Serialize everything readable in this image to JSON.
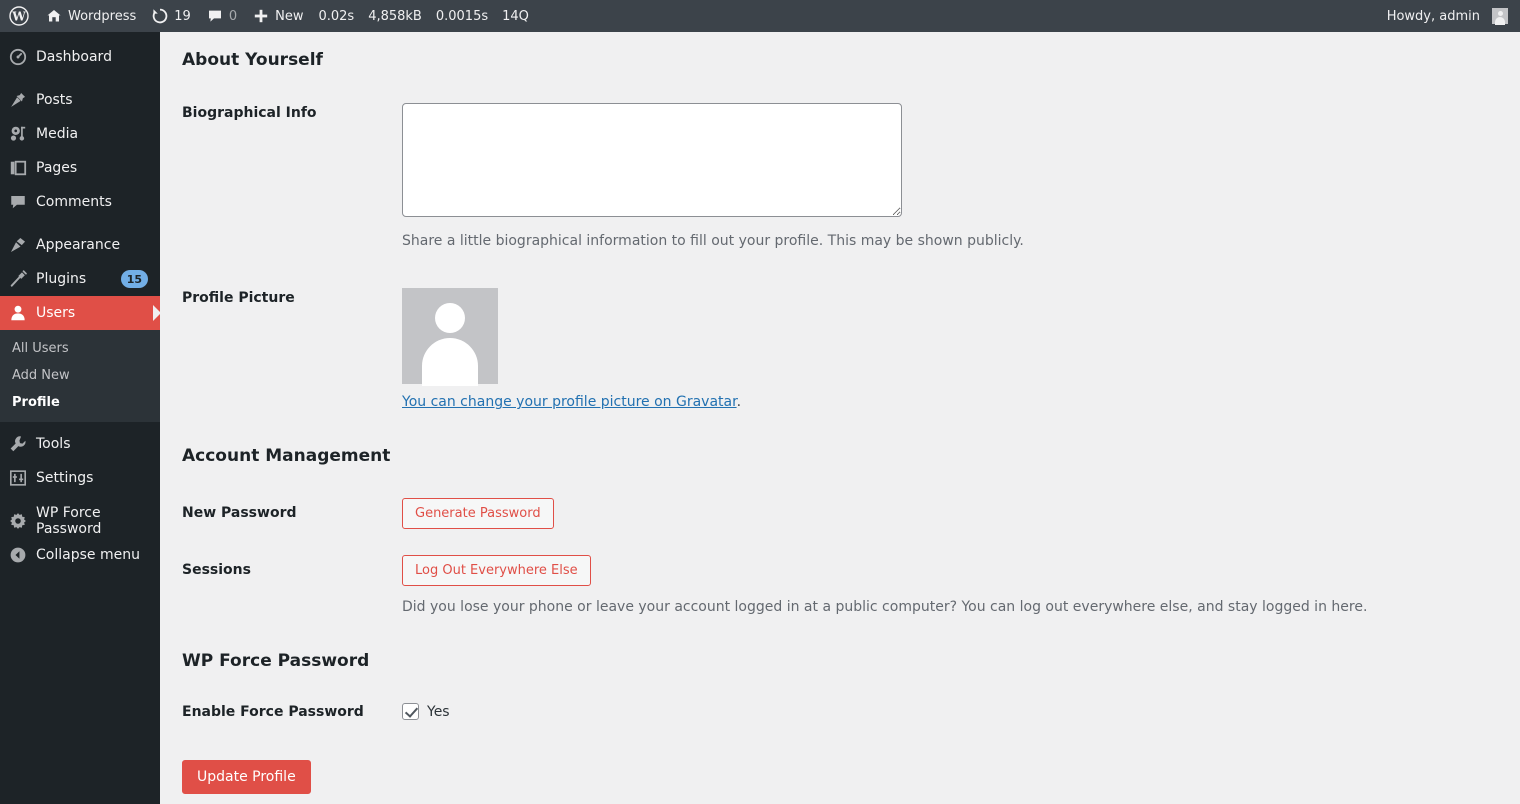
{
  "adminbar": {
    "wp_logo": "wordpress-logo-icon",
    "site_name": "Wordpress",
    "site_icon": "home-icon",
    "updates_icon": "updates-icon",
    "updates_count": "19",
    "comments_icon": "comment-bubble-icon",
    "comments_count": "0",
    "new_icon": "plus-icon",
    "new_label": "New",
    "stats": [
      "0.02s",
      "4,858kB",
      "0.0015s",
      "14Q"
    ],
    "howdy": "Howdy, admin",
    "avatar_icon": "user-avatar-icon"
  },
  "sidebar": {
    "items": [
      {
        "label": "Dashboard",
        "icon": "dashboard-icon",
        "current": false,
        "badge": null
      },
      {
        "label": "Posts",
        "icon": "pin-icon",
        "current": false,
        "badge": null
      },
      {
        "label": "Media",
        "icon": "media-icon",
        "current": false,
        "badge": null
      },
      {
        "label": "Pages",
        "icon": "pages-icon",
        "current": false,
        "badge": null
      },
      {
        "label": "Comments",
        "icon": "comment-bubble-icon",
        "current": false,
        "badge": null
      },
      {
        "label": "Appearance",
        "icon": "paint-brush-icon",
        "current": false,
        "badge": null
      },
      {
        "label": "Plugins",
        "icon": "plug-icon",
        "current": false,
        "badge": "15"
      },
      {
        "label": "Users",
        "icon": "user-icon",
        "current": true,
        "badge": null
      },
      {
        "label": "Tools",
        "icon": "wrench-icon",
        "current": false,
        "badge": null
      },
      {
        "label": "Settings",
        "icon": "settings-sliders-icon",
        "current": false,
        "badge": null
      },
      {
        "label": "WP Force Password",
        "icon": "gear-icon",
        "current": false,
        "badge": null
      },
      {
        "label": "Collapse menu",
        "icon": "collapse-arrow-icon",
        "current": false,
        "badge": null
      }
    ],
    "submenu": [
      {
        "label": "All Users",
        "current": false
      },
      {
        "label": "Add New",
        "current": false
      },
      {
        "label": "Profile",
        "current": true
      }
    ]
  },
  "main": {
    "about_yourself": {
      "heading": "About Yourself",
      "bio_label": "Biographical Info",
      "bio_value": "",
      "bio_placeholder": "",
      "bio_description": "Share a little biographical information to fill out your profile. This may be shown publicly.",
      "picture_label": "Profile Picture",
      "avatar_icon": "default-avatar-icon",
      "gravatar_link_text": "You can change your profile picture on Gravatar",
      "gravatar_trailing": "."
    },
    "account_management": {
      "heading": "Account Management",
      "password_label": "New Password",
      "generate_password_button": "Generate Password",
      "sessions_label": "Sessions",
      "logout_button": "Log Out Everywhere Else",
      "sessions_description": "Did you lose your phone or leave your account logged in at a public computer? You can log out everywhere else, and stay logged in here."
    },
    "wp_force_password": {
      "heading": "WP Force Password",
      "enable_label": "Enable Force Password",
      "checkbox_checked": true,
      "checkbox_label": "Yes"
    },
    "submit_button": "Update Profile"
  },
  "colors": {
    "adminbar_bg": "#3c434a",
    "sidebar_bg": "#1d2327",
    "submenu_bg": "#2c3338",
    "accent_red": "#e04f47",
    "badge_blue": "#72aee6",
    "link_blue": "#2271b1",
    "content_bg": "#f0f0f1"
  }
}
